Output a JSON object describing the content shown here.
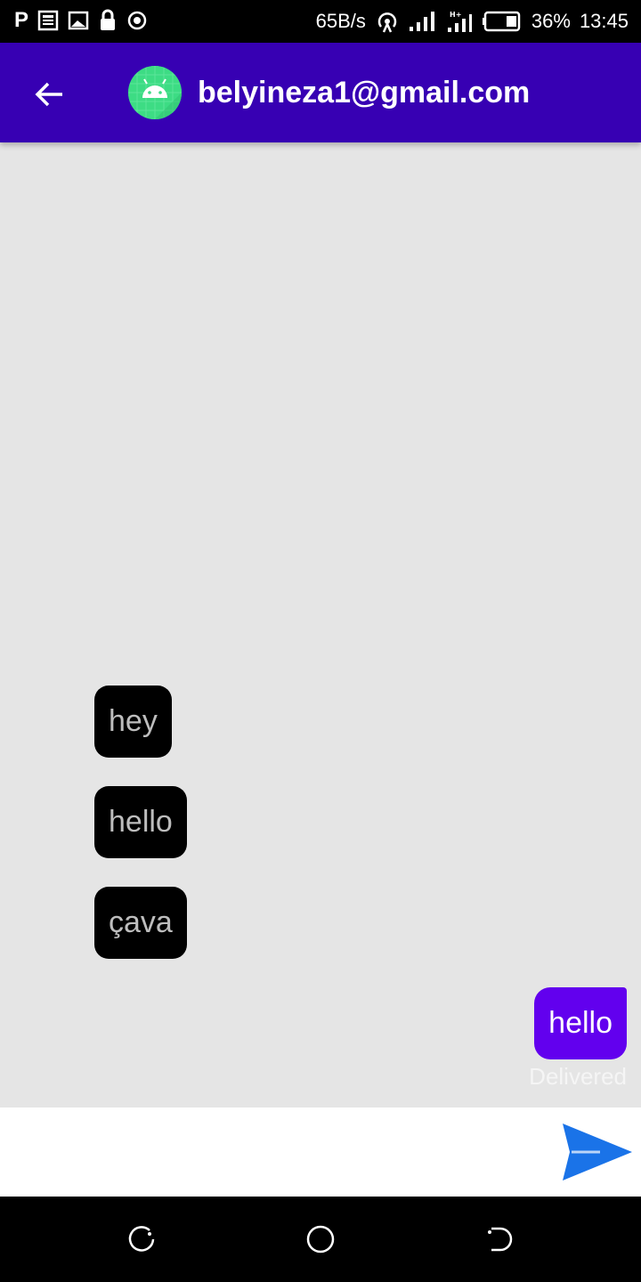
{
  "status_bar": {
    "network_speed": "65B/s",
    "battery_percent": "36%",
    "time": "13:45",
    "icons": [
      "p-icon",
      "news-icon",
      "picture-icon",
      "lock-icon",
      "record-icon",
      "hotspot-icon",
      "signal-icon",
      "signal-h-plus-icon",
      "battery-icon"
    ],
    "battery_level": 0.36
  },
  "app_bar": {
    "title": "belyineza1@gmail.com",
    "back_icon": "arrow-back-icon",
    "avatar_icon": "android-icon",
    "color": "#3700b3"
  },
  "messages": {
    "incoming": [
      {
        "text": "hey"
      },
      {
        "text": "hello"
      },
      {
        "text": "çava"
      }
    ],
    "outgoing": [
      {
        "text": "hello",
        "status": "Delivered"
      }
    ],
    "incoming_color": "#000000",
    "outgoing_color": "#6200ee"
  },
  "composer": {
    "input_value": "",
    "placeholder": "",
    "send_icon": "send-icon",
    "send_color": "#1a73e8"
  },
  "nav_bar": {
    "icons": [
      "recent-apps-icon",
      "home-icon",
      "back-icon"
    ]
  }
}
